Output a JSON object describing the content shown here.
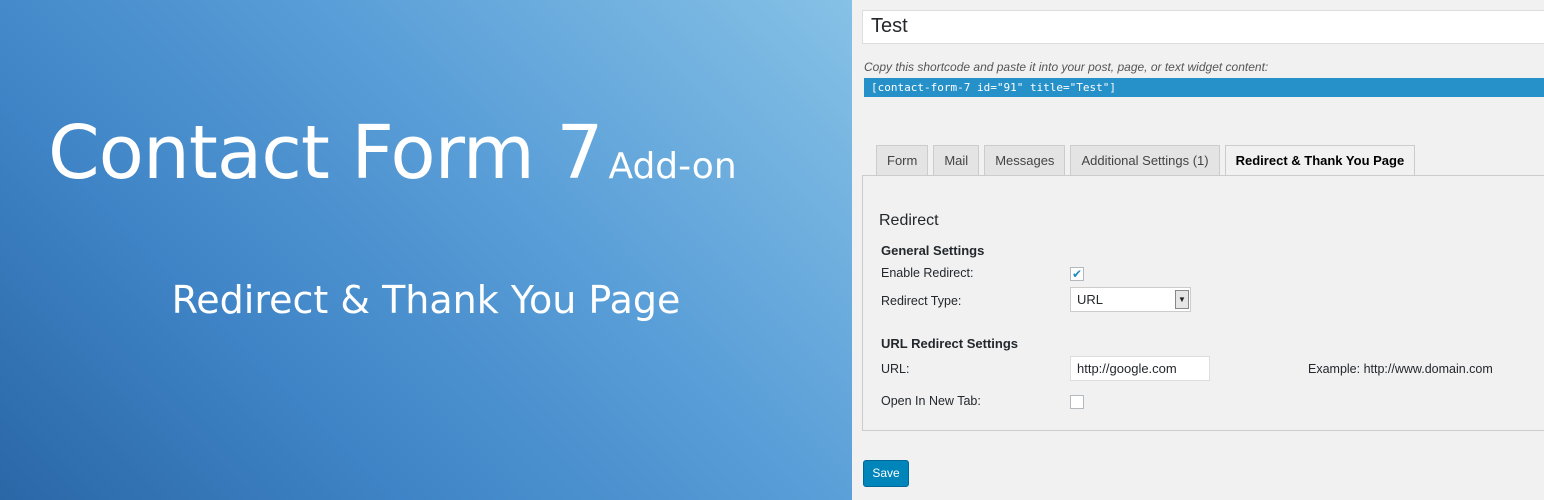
{
  "banner": {
    "title": "Contact Form 7",
    "addon": "Add-on",
    "subtitle": "Redirect & Thank You Page"
  },
  "form": {
    "title_value": "Test",
    "shortcode_hint": "Copy this shortcode and paste it into your post, page, or text widget content:",
    "shortcode": "[contact-form-7 id=\"91\" title=\"Test\"]"
  },
  "tabs": [
    {
      "label": "Form"
    },
    {
      "label": "Mail"
    },
    {
      "label": "Messages"
    },
    {
      "label": "Additional Settings (1)"
    },
    {
      "label": "Redirect & Thank You Page",
      "active": true
    }
  ],
  "redirect": {
    "section_title": "Redirect",
    "general_settings": "General Settings",
    "enable_redirect_label": "Enable Redirect:",
    "enable_redirect_checked": true,
    "checkmark": "✔",
    "redirect_type_label": "Redirect Type:",
    "redirect_type_value": "URL",
    "dropdown_arrow": "▼",
    "url_settings": "URL Redirect Settings",
    "url_label": "URL:",
    "url_value": "http://google.com",
    "url_example": "Example: http://www.domain.com",
    "open_new_tab_label": "Open In New Tab:",
    "open_new_tab_checked": false
  },
  "actions": {
    "save_label": "Save"
  },
  "colors": {
    "accent": "#0085ba",
    "shortcode_bg": "#2691c8",
    "checkmark": "#1e8cbe"
  }
}
